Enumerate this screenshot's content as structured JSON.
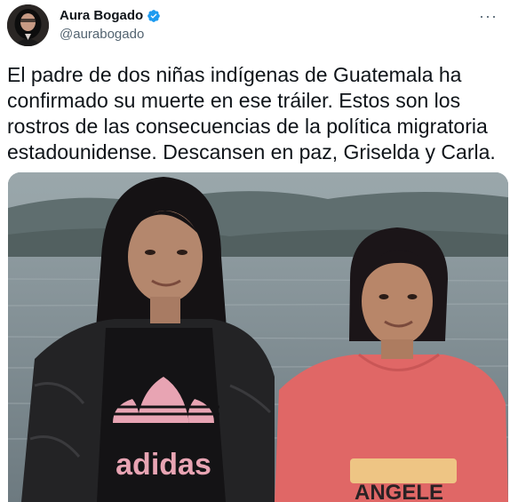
{
  "author": {
    "display_name": "Aura Bogado",
    "handle": "@aurabogado",
    "verified": true,
    "avatar_icon": "profile-photo-avatar",
    "verified_icon": "verified-badge-icon",
    "verified_color": "#1d9bf0"
  },
  "menu": {
    "more_icon": "more-options-icon",
    "glyph": "···"
  },
  "tweet": {
    "text": "El padre de dos niñas indígenas de Guatemala ha confirmado su muerte en ese tráiler. Estos son los rostros de las consecuencias de la política migratoria estadounidense. Descansen en paz, Griselda y Carla."
  },
  "media": {
    "shirt_left_text": "adidas",
    "shirt_right_text": "ANGELE"
  }
}
